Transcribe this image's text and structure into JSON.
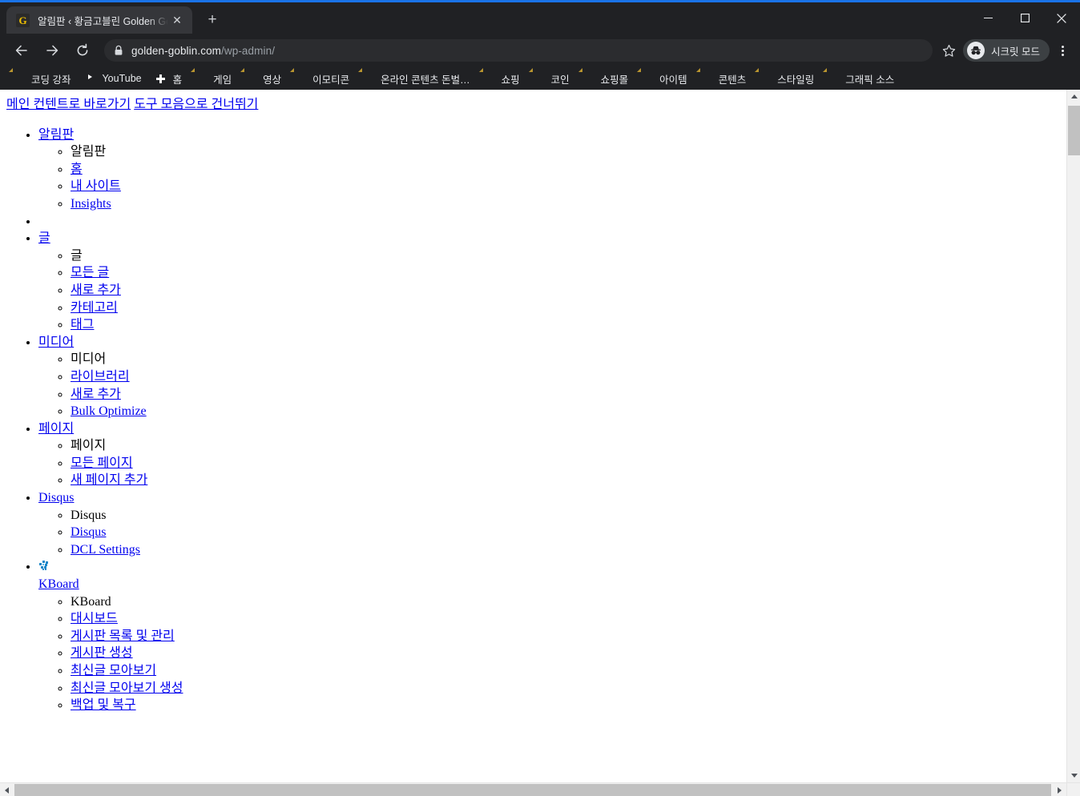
{
  "browser": {
    "tab": {
      "favicon_letter": "G",
      "title": "알림판 ‹ 황금고블린 Golden Gob",
      "close_label": "✕"
    },
    "new_tab_label": "+",
    "window_controls": {
      "minimize": "minimize-icon",
      "maximize": "maximize-icon",
      "close": "close-icon"
    },
    "toolbar": {
      "back": "back-icon",
      "forward": "forward-icon",
      "reload": "reload-icon",
      "lock": "lock-icon",
      "url_host": "golden-goblin.com",
      "url_path": "/wp-admin/",
      "star": "star-icon",
      "incognito_label": "시크릿 모드",
      "menu": "three-dot-menu-icon"
    },
    "bookmarks": [
      {
        "label": "코딩 강좌",
        "icon": "folder-icon"
      },
      {
        "label": "YouTube",
        "icon": "youtube-icon"
      },
      {
        "label": "홈",
        "icon": "blue-plus-icon"
      },
      {
        "label": "게임",
        "icon": "folder-icon"
      },
      {
        "label": "영상",
        "icon": "folder-icon"
      },
      {
        "label": "이모티콘",
        "icon": "folder-icon"
      },
      {
        "label": "온라인 콘텐츠 돈벌…",
        "icon": "folder-icon"
      },
      {
        "label": "쇼핑",
        "icon": "folder-icon"
      },
      {
        "label": "코인",
        "icon": "folder-icon"
      },
      {
        "label": "쇼핑몰",
        "icon": "folder-icon"
      },
      {
        "label": "아이템",
        "icon": "folder-icon"
      },
      {
        "label": "콘텐츠",
        "icon": "folder-icon"
      },
      {
        "label": "스타일링",
        "icon": "folder-icon"
      },
      {
        "label": "그래픽 소스",
        "icon": "folder-icon"
      }
    ]
  },
  "page": {
    "skip_links": [
      "메인 컨텐트로 바로가기",
      "도구 모음으로 건너뛰기"
    ],
    "menu": [
      {
        "label": "알림판",
        "icon": null,
        "submenu": [
          {
            "label": "알림판",
            "link": false
          },
          {
            "label": "홈",
            "link": true
          },
          {
            "label": "내 사이트",
            "link": true
          },
          {
            "label": "Insights",
            "link": true
          }
        ]
      },
      {
        "label": "",
        "separator": true,
        "submenu": []
      },
      {
        "label": "글",
        "icon": null,
        "submenu": [
          {
            "label": "글",
            "link": false
          },
          {
            "label": "모든 글",
            "link": true
          },
          {
            "label": "새로 추가",
            "link": true
          },
          {
            "label": "카테고리",
            "link": true
          },
          {
            "label": "태그",
            "link": true
          }
        ]
      },
      {
        "label": "미디어",
        "icon": null,
        "submenu": [
          {
            "label": "미디어",
            "link": false
          },
          {
            "label": "라이브러리",
            "link": true
          },
          {
            "label": "새로 추가",
            "link": true
          },
          {
            "label": "Bulk Optimize",
            "link": true
          }
        ]
      },
      {
        "label": "페이지",
        "icon": null,
        "submenu": [
          {
            "label": "페이지",
            "link": false
          },
          {
            "label": "모든 페이지",
            "link": true
          },
          {
            "label": "새 페이지 추가",
            "link": true
          }
        ]
      },
      {
        "label": "Disqus",
        "icon": null,
        "submenu": [
          {
            "label": "Disqus",
            "link": false
          },
          {
            "label": "Disqus",
            "link": true
          },
          {
            "label": "DCL Settings",
            "link": true
          }
        ]
      },
      {
        "label": "KBoard",
        "icon": "kboard-icon",
        "submenu": [
          {
            "label": "KBoard",
            "link": false
          },
          {
            "label": "대시보드",
            "link": true
          },
          {
            "label": "게시판 목록 및 관리",
            "link": true
          },
          {
            "label": "게시판 생성",
            "link": true
          },
          {
            "label": "최신글 모아보기",
            "link": true
          },
          {
            "label": "최신글 모아보기 생성",
            "link": true
          },
          {
            "label": "백업 및 복구",
            "link": true
          }
        ]
      }
    ]
  },
  "colors": {
    "chrome_bg": "#202124",
    "tab_active": "#35363a",
    "accent_blue": "#1a73e8",
    "link": "#0000ee",
    "bookmark_folder": "#fdd663",
    "kboard_icon": "#1b87c9",
    "favicon_gold": "#f2c200"
  }
}
